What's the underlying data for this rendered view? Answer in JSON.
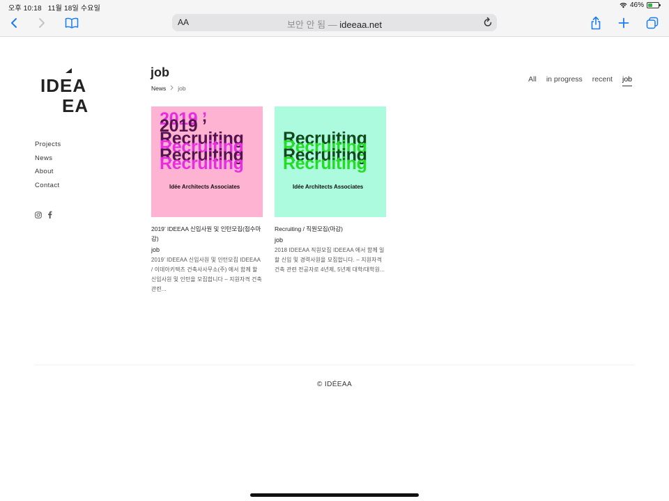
{
  "status_bar": {
    "time": "오후 10:18",
    "date": "11월 18일 수요일",
    "battery": "46%",
    "battery_level": 0.46
  },
  "browser": {
    "aa_label": "AA",
    "url_insecure": "보안 안 됨 —",
    "url_domain": "ideeaa.net"
  },
  "site": {
    "logo_line1": "IDEA",
    "logo_line2": "EA",
    "nav": [
      "Projects",
      "News",
      "About",
      "Contact"
    ],
    "footer": "© IDÉEAA"
  },
  "page": {
    "title": "job",
    "breadcrumb": [
      "News",
      "job"
    ],
    "filters": [
      "All",
      "in progress",
      "recent",
      "job"
    ],
    "active_filter": "job"
  },
  "posts": [
    {
      "thumb_lines": [
        "2019 ’",
        "2019 ’",
        "Recruiting",
        "Recruiting",
        "Recruiting",
        "Recruiting"
      ],
      "thumb_company": "Idée Architects Associates",
      "title": "2019’ IDEEAA 신입사원 및 인턴모집(접수마감)",
      "category": "job",
      "excerpt": "2019’ IDEEAA 신입사원 및 인턴모집 IDEEAA / 이데아키텍츠 건축사사무소(주) 에서 함께 할 신입사원 및 인턴을 모집합니다 – 지원자격 건축 관련..."
    },
    {
      "thumb_lines": [
        "Recruiting",
        "Recruiting",
        "Recruiting",
        "Recruiting"
      ],
      "thumb_company": "Idée Architects Associates",
      "title": "Recruiting / 직원모집(마감)",
      "category": "job",
      "excerpt": "2018 IDEEAA 직원모집 IDEEAA 에서 함께 일할 신입 및 경력사원을 모집합니다. – 지원자격 건축 관련 전공자로 4년제, 5년제 대학/대학원..."
    }
  ],
  "colors": {
    "post1_bg": "#ffb3d2",
    "post1_accent": "#e62ee0",
    "post1_dark": "#55124f",
    "post2_bg": "#adfbde",
    "post2_accent": "#22dd22",
    "post2_dark": "#0f4a1a"
  }
}
